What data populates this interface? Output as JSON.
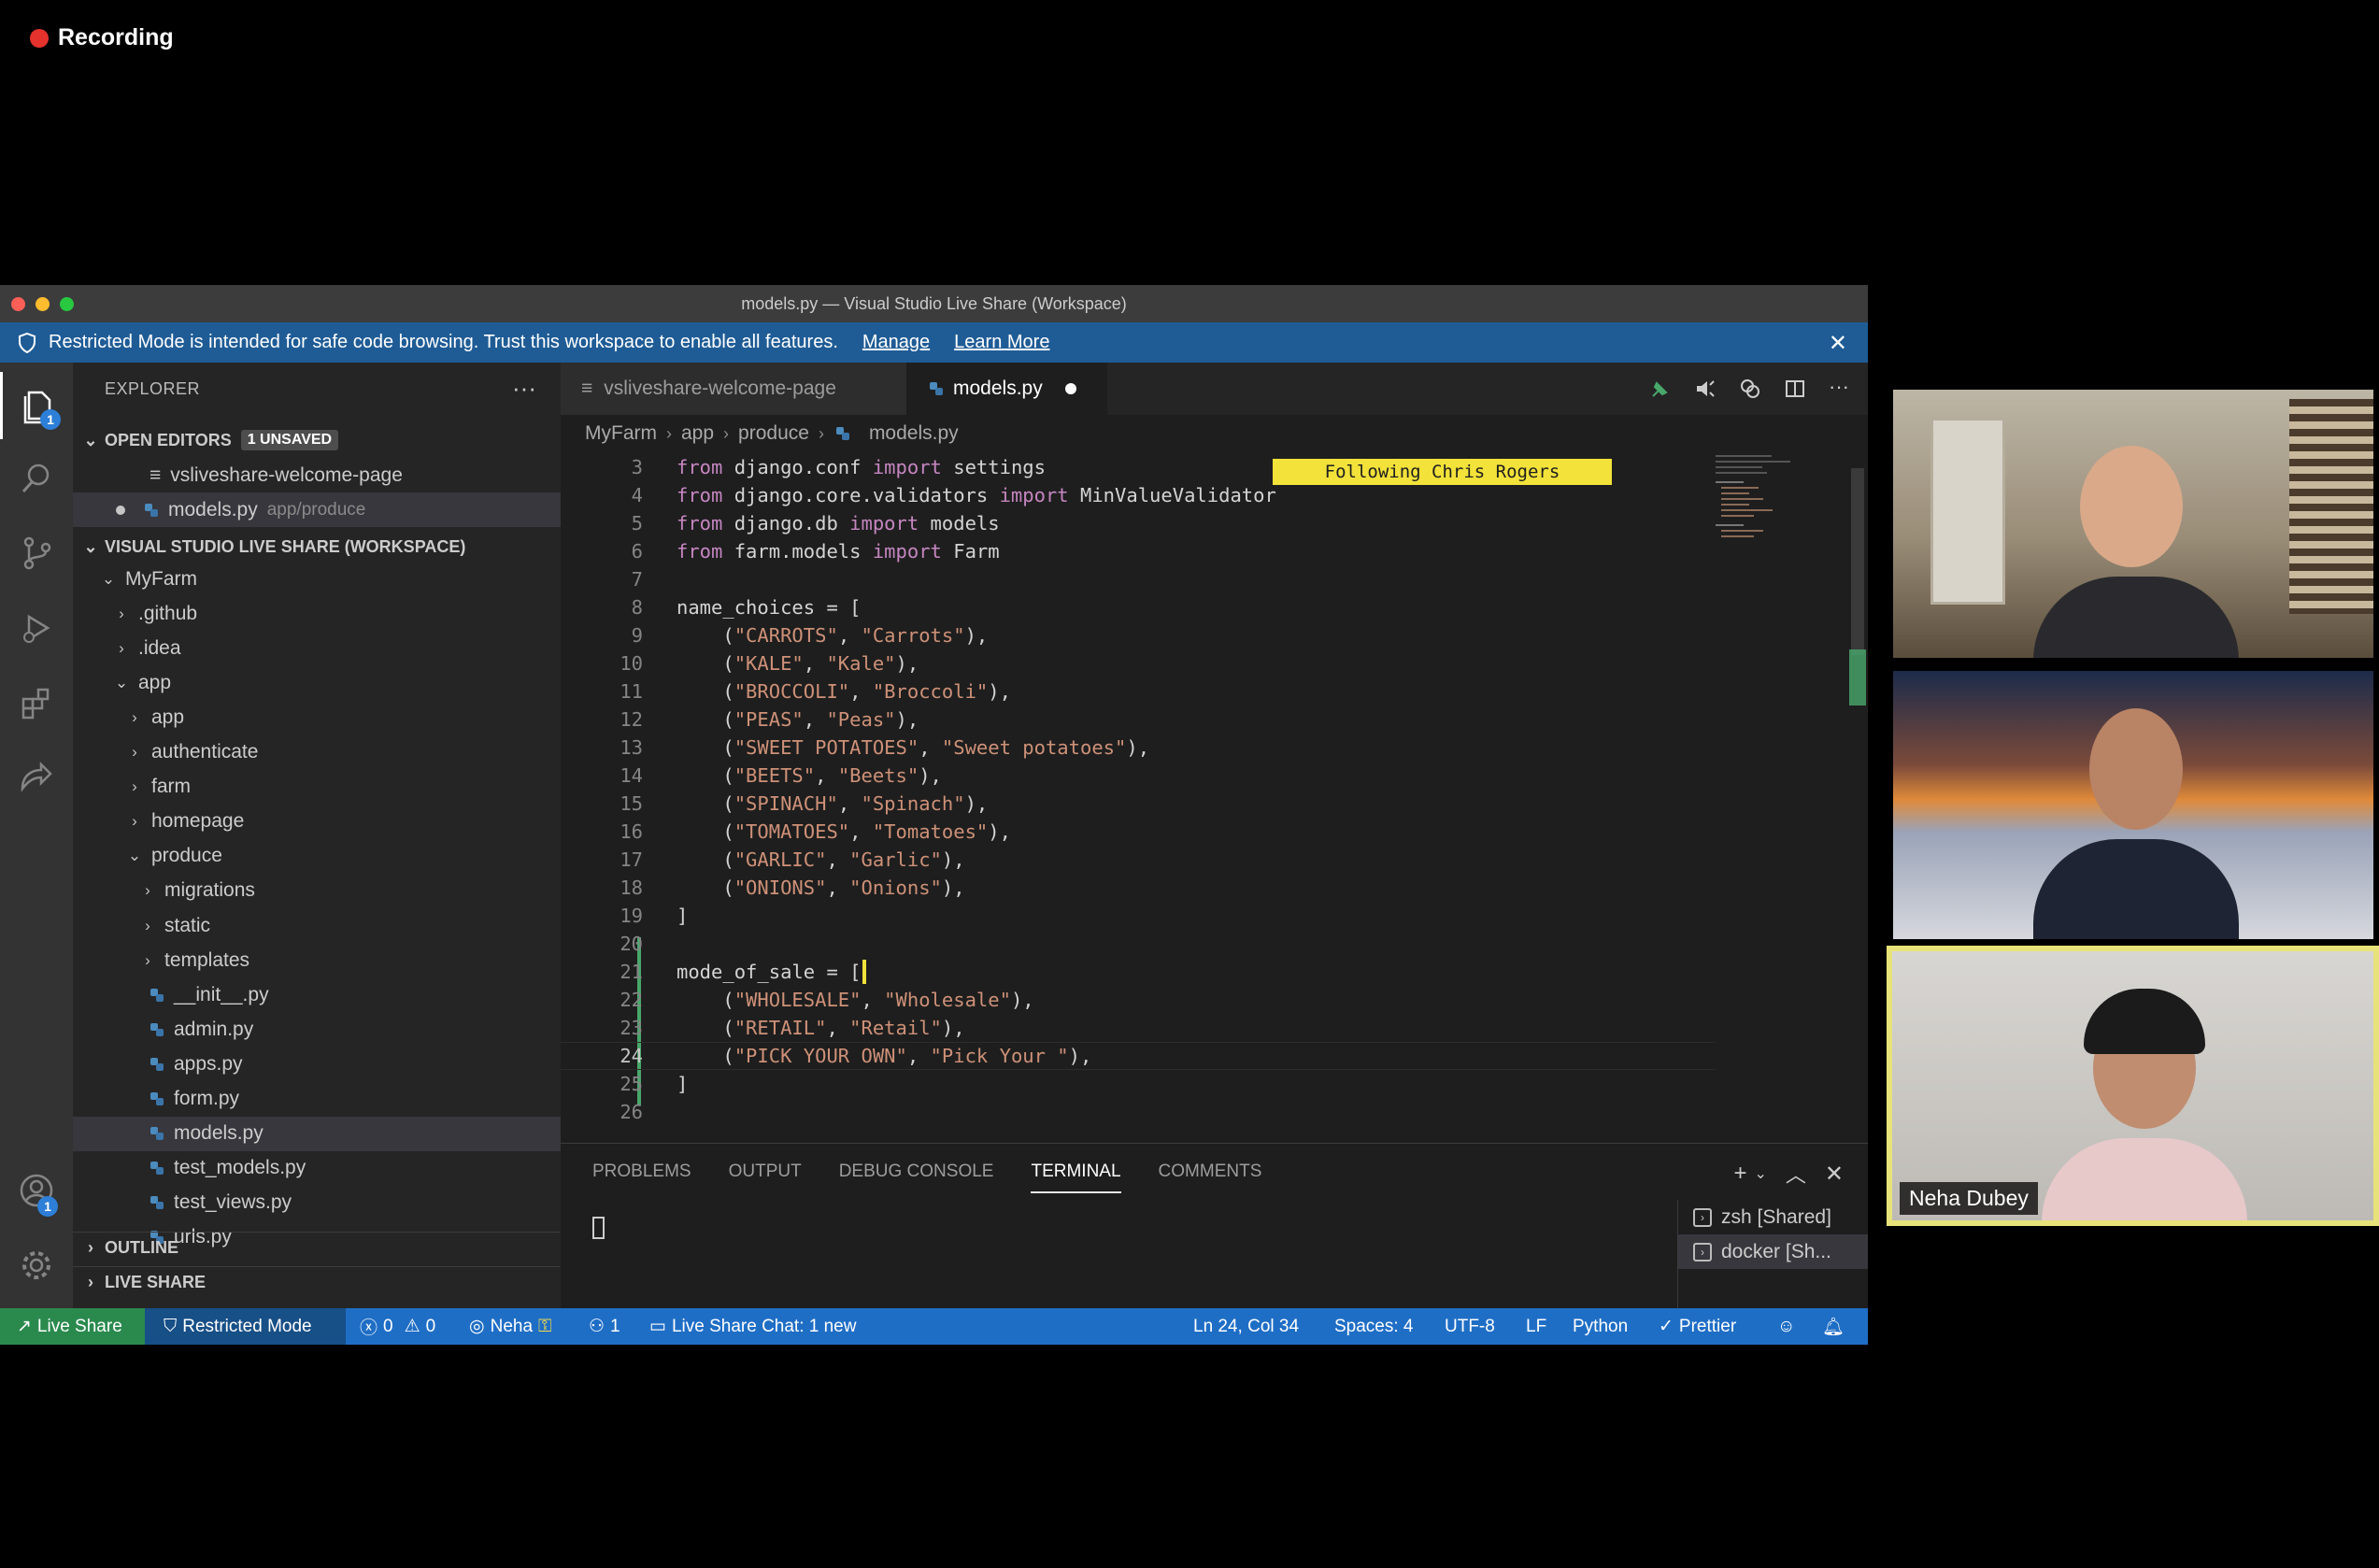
{
  "recording": {
    "label": "Recording"
  },
  "window": {
    "title": "models.py — Visual Studio Live Share (Workspace)"
  },
  "banner": {
    "text": "Restricted Mode is intended for safe code browsing. Trust this workspace to enable all features.",
    "manage": "Manage",
    "learn_more": "Learn More"
  },
  "activity": {
    "explorer_badge": "1",
    "accounts_badge": "1"
  },
  "sidebar": {
    "title": "EXPLORER",
    "open_editors": {
      "label": "OPEN EDITORS",
      "badge": "1 UNSAVED",
      "items": [
        {
          "name": "vsliveshare-welcome-page",
          "path": ""
        },
        {
          "name": "models.py",
          "path": "app/produce"
        }
      ]
    },
    "workspace": {
      "label": "VISUAL STUDIO LIVE SHARE (WORKSPACE)"
    },
    "tree": [
      {
        "label": "MyFarm"
      },
      {
        "label": ".github"
      },
      {
        "label": ".idea"
      },
      {
        "label": "app"
      },
      {
        "label": "app"
      },
      {
        "label": "authenticate"
      },
      {
        "label": "farm"
      },
      {
        "label": "homepage"
      },
      {
        "label": "produce"
      },
      {
        "label": "migrations"
      },
      {
        "label": "static"
      },
      {
        "label": "templates"
      },
      {
        "label": "__init__.py"
      },
      {
        "label": "admin.py"
      },
      {
        "label": "apps.py"
      },
      {
        "label": "form.py"
      },
      {
        "label": "models.py"
      },
      {
        "label": "test_models.py"
      },
      {
        "label": "test_views.py"
      },
      {
        "label": "urls.py"
      }
    ],
    "outline": "OUTLINE",
    "live_share": "LIVE SHARE"
  },
  "tabs": [
    {
      "label": "vsliveshare-welcome-page"
    },
    {
      "label": "models.py"
    }
  ],
  "breadcrumb": [
    "MyFarm",
    "app",
    "produce",
    "models.py"
  ],
  "follow_label": "Following Chris Rogers",
  "code": {
    "lines": [
      {
        "n": "3"
      },
      {
        "n": "4"
      },
      {
        "n": "5"
      },
      {
        "n": "6"
      },
      {
        "n": "7"
      },
      {
        "n": "8"
      },
      {
        "n": "9"
      },
      {
        "n": "10"
      },
      {
        "n": "11"
      },
      {
        "n": "12"
      },
      {
        "n": "13"
      },
      {
        "n": "14"
      },
      {
        "n": "15"
      },
      {
        "n": "16"
      },
      {
        "n": "17"
      },
      {
        "n": "18"
      },
      {
        "n": "19"
      },
      {
        "n": "20"
      },
      {
        "n": "21"
      },
      {
        "n": "22"
      },
      {
        "n": "23"
      },
      {
        "n": "24"
      },
      {
        "n": "25"
      },
      {
        "n": "26"
      }
    ],
    "text": {
      "l3a": "from",
      "l3b": " django.conf ",
      "l3c": "import",
      "l3d": " settings",
      "l4a": "from",
      "l4b": " django.core.validators ",
      "l4c": "import",
      "l4d": " MinValueValidator",
      "l5a": "from",
      "l5b": " django.db ",
      "l5c": "import",
      "l5d": " models",
      "l6a": "from",
      "l6b": " farm.models ",
      "l6c": "import",
      "l6d": " Farm",
      "l8": "name_choices = [",
      "l9a": "\"CARROTS\"",
      "l9b": "\"Carrots\"",
      "l10a": "\"KALE\"",
      "l10b": "\"Kale\"",
      "l11a": "\"BROCCOLI\"",
      "l11b": "\"Broccoli\"",
      "l12a": "\"PEAS\"",
      "l12b": "\"Peas\"",
      "l13a": "\"SWEET POTATOES\"",
      "l13b": "\"Sweet potatoes\"",
      "l14a": "\"BEETS\"",
      "l14b": "\"Beets\"",
      "l15a": "\"SPINACH\"",
      "l15b": "\"Spinach\"",
      "l16a": "\"TOMATOES\"",
      "l16b": "\"Tomatoes\"",
      "l17a": "\"GARLIC\"",
      "l17b": "\"Garlic\"",
      "l18a": "\"ONIONS\"",
      "l18b": "\"Onions\"",
      "l19": "]",
      "l21": "mode_of_sale = [",
      "l22a": "\"WHOLESALE\"",
      "l22b": "\"Wholesale\"",
      "l23a": "\"RETAIL\"",
      "l23b": "\"Retail\"",
      "l24a": "\"PICK YOUR OWN\"",
      "l24b": "\"Pick Your \"",
      "l25": "]"
    }
  },
  "panel": {
    "tabs": [
      "PROBLEMS",
      "OUTPUT",
      "DEBUG CONSOLE",
      "TERMINAL",
      "COMMENTS"
    ],
    "terminals": [
      "zsh [Shared]",
      "docker [Sh..."
    ]
  },
  "status": {
    "live_share": "Live Share",
    "restricted": "Restricted Mode",
    "errors": "0",
    "warnings": "0",
    "user": "Neha",
    "participants": "1",
    "chat": "Live Share Chat: 1 new",
    "position": "Ln 24, Col 34",
    "spaces": "Spaces: 4",
    "encoding": "UTF-8",
    "eol": "LF",
    "language": "Python",
    "prettier": "Prettier"
  },
  "videos": {
    "third_name": "Neha Dubey"
  }
}
